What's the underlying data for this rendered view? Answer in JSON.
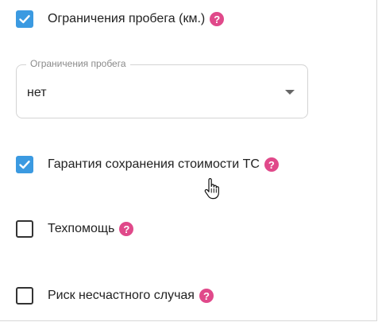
{
  "options": [
    {
      "label": "Ограничения пробега (км.)",
      "checked": true,
      "help": "?"
    },
    {
      "label": "Гарантия сохранения стоимости ТС",
      "checked": true,
      "help": "?"
    },
    {
      "label": "Техпомощь",
      "checked": false,
      "help": "?"
    },
    {
      "label": "Риск несчастного случая",
      "checked": false,
      "help": "?"
    }
  ],
  "mileage_select": {
    "legend": "Ограничения пробега",
    "value": "нет"
  },
  "colors": {
    "checkbox_checked": "#3b9ae1",
    "help_badge": "#e0498a",
    "checkbox_border": "#333333"
  },
  "icons": {
    "check": "check-icon",
    "help": "question-icon",
    "dropdown": "caret-down-icon",
    "cursor": "hand-pointer-icon"
  }
}
